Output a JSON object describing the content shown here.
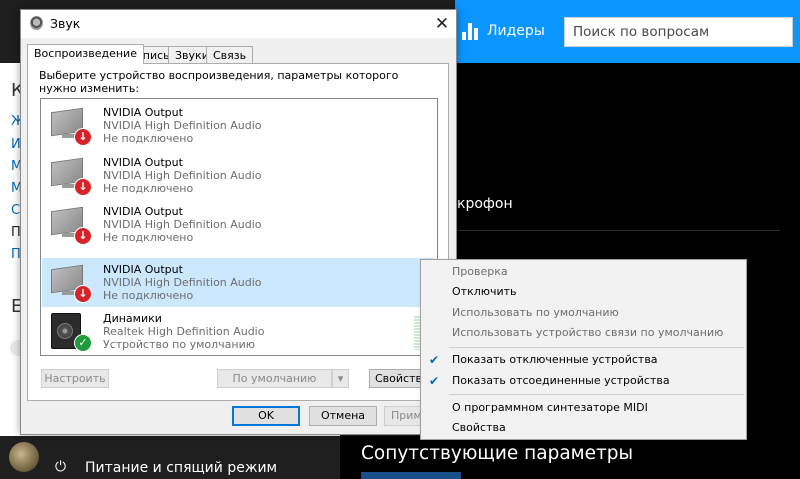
{
  "background": {
    "header": {
      "leaders_label": "Лидеры",
      "search_placeholder": "Поиск по вопросам"
    },
    "left_fragments": [
      "К",
      "Ж",
      "И",
      "М",
      "М",
      "С",
      "П",
      "П",
      "Е"
    ],
    "mic_partial": "крофон",
    "related_title": "Сопутствующие параметры",
    "power_label": "Питание и спящий режим"
  },
  "dialog": {
    "title": "Звук",
    "tabs": [
      "Воспроизведение",
      "Запись",
      "Звуки",
      "Связь"
    ],
    "instructions": "Выберите устройство воспроизведения, параметры которого нужно изменить:",
    "devices": [
      {
        "name": "NVIDIA Output",
        "driver": "NVIDIA High Definition Audio",
        "status": "Не подключено",
        "icon": "monitor-icon",
        "badge": "disconnected-badge-icon"
      },
      {
        "name": "NVIDIA Output",
        "driver": "NVIDIA High Definition Audio",
        "status": "Не подключено",
        "icon": "monitor-icon",
        "badge": "disconnected-badge-icon"
      },
      {
        "name": "NVIDIA Output",
        "driver": "NVIDIA High Definition Audio",
        "status": "Не подключено",
        "icon": "monitor-icon",
        "badge": "disconnected-badge-icon"
      },
      {
        "name": "NVIDIA Output",
        "driver": "NVIDIA High Definition Audio",
        "status": "Не подключено",
        "icon": "monitor-icon",
        "badge": "disconnected-badge-icon"
      },
      {
        "name": "Динамики",
        "driver": "Realtek High Definition Audio",
        "status": "Устройство по умолчанию",
        "icon": "speaker-icon",
        "badge": "default-check-badge-icon"
      }
    ],
    "selected_device_index": 3,
    "buttons": {
      "configure": "Настроить",
      "set_default": "По умолчанию",
      "properties": "Свойства",
      "ok": "OK",
      "cancel": "Отмена",
      "apply": "Применить"
    }
  },
  "context_menu": {
    "items": [
      {
        "label": "Проверка",
        "enabled": false,
        "checked": false
      },
      {
        "label": "Отключить",
        "enabled": true,
        "checked": false
      },
      {
        "label": "Использовать по умолчанию",
        "enabled": false,
        "checked": false
      },
      {
        "label": "Использовать устройство связи по умолчанию",
        "enabled": false,
        "checked": false
      },
      {
        "label": "Показать отключенные устройства",
        "enabled": true,
        "checked": true
      },
      {
        "label": "Показать отсоединенные устройства",
        "enabled": true,
        "checked": true
      },
      {
        "label": "О программном синтезаторе MIDI",
        "enabled": true,
        "checked": false
      },
      {
        "label": "Свойства",
        "enabled": true,
        "checked": false
      }
    ]
  },
  "colors": {
    "selection": "#cce8ff",
    "accent": "#0078d7",
    "so_blue": "#0a95ff",
    "disconnected": "#d8222a",
    "ok_green": "#1e9b3b"
  }
}
